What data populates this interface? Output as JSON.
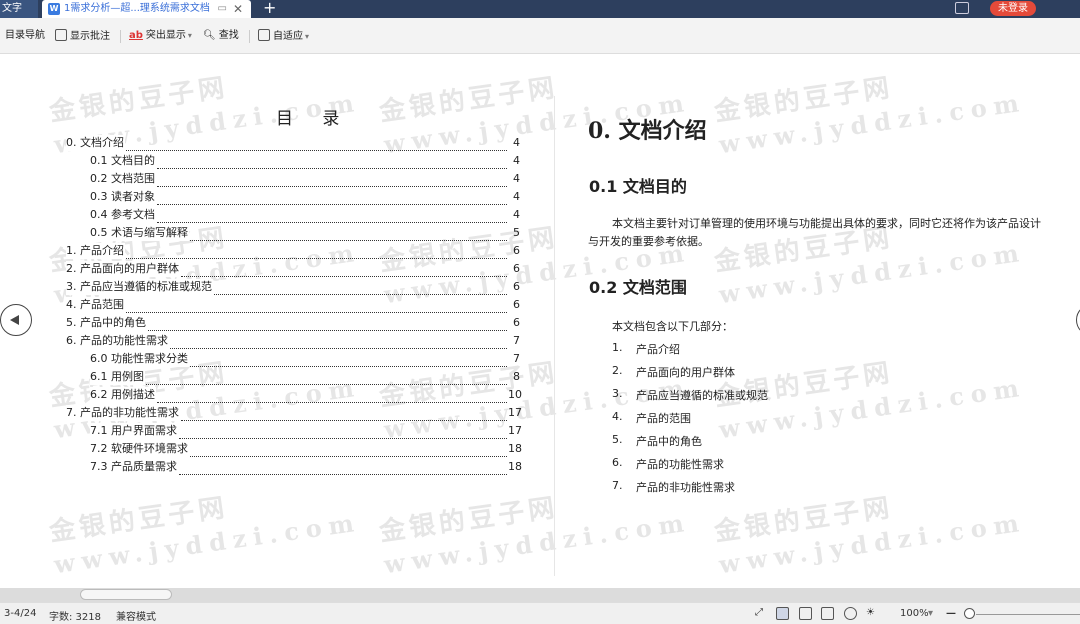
{
  "tabs": {
    "left_label": "文字",
    "active_title": "1需求分析—超...理系统需求文档",
    "doc_icon": "W",
    "add": "+",
    "close": "✕",
    "login": "未登录"
  },
  "toolbar": {
    "nav": "目录导航",
    "comments": "显示批注",
    "highlight": "突出显示",
    "find": "查找",
    "fit": "自适应"
  },
  "watermark": {
    "cn": "金银的豆子网",
    "en": "www.jyddzi.com"
  },
  "toc": {
    "title": "目 录",
    "items": [
      {
        "label": "0. 文档介绍",
        "page": "4",
        "level": 1
      },
      {
        "label": "0.1 文档目的",
        "page": "4",
        "level": 2
      },
      {
        "label": "0.2 文档范围",
        "page": "4",
        "level": 2
      },
      {
        "label": "0.3 读者对象",
        "page": "4",
        "level": 2
      },
      {
        "label": "0.4 参考文档",
        "page": "4",
        "level": 2
      },
      {
        "label": "0.5 术语与缩写解释",
        "page": "5",
        "level": 2
      },
      {
        "label": "1. 产品介绍",
        "page": "6",
        "level": 1
      },
      {
        "label": "2. 产品面向的用户群体",
        "page": "6",
        "level": 1
      },
      {
        "label": "3. 产品应当遵循的标准或规范",
        "page": "6",
        "level": 1
      },
      {
        "label": "4. 产品范围",
        "page": "6",
        "level": 1
      },
      {
        "label": "5. 产品中的角色",
        "page": "6",
        "level": 1
      },
      {
        "label": "6. 产品的功能性需求",
        "page": "7",
        "level": 1
      },
      {
        "label": "6.0 功能性需求分类",
        "page": "7",
        "level": 2
      },
      {
        "label": "6.1 用例图",
        "page": "8",
        "level": 2
      },
      {
        "label": "6.2 用例描述",
        "page": "10",
        "level": 2
      },
      {
        "label": "7. 产品的非功能性需求",
        "page": "17",
        "level": 1
      },
      {
        "label": "7.1 用户界面需求",
        "page": "17",
        "level": 2
      },
      {
        "label": "7.2 软硬件环境需求",
        "page": "18",
        "level": 2
      },
      {
        "label": "7.3 产品质量需求",
        "page": "18",
        "level": 2
      }
    ]
  },
  "content": {
    "h1": "0.  文档介绍",
    "h2_purpose": "0.1  文档目的",
    "purpose_text": "本文档主要针对订单管理的使用环境与功能提出具体的要求，同时它还将作为该产品设计与开发的重要参考依据。",
    "h2_scope": "0.2  文档范围",
    "scope_intro": "本文档包含以下几部分：",
    "scope_items": [
      {
        "num": "1.",
        "text": "产品介绍"
      },
      {
        "num": "2.",
        "text": "产品面向的用户群体"
      },
      {
        "num": "3.",
        "text": "产品应当遵循的标准或规范"
      },
      {
        "num": "4.",
        "text": "产品的范围"
      },
      {
        "num": "5.",
        "text": "产品中的角色"
      },
      {
        "num": "6.",
        "text": "产品的功能性需求"
      },
      {
        "num": "7.",
        "text": "产品的非功能性需求"
      }
    ]
  },
  "status": {
    "pages": "3-4/24",
    "wordcount": "字数: 3218",
    "mode": "兼容模式",
    "zoom": "100%"
  }
}
